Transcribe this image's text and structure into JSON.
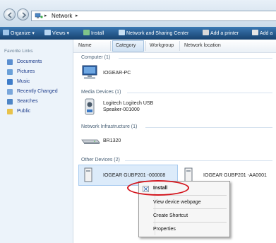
{
  "address": {
    "location": "Network"
  },
  "toolbar": {
    "organize": "Organize",
    "views": "Views",
    "install": "Install",
    "network_sharing": "Network and Sharing Center",
    "add_printer": "Add a printer",
    "add_more": "Add a"
  },
  "leftnav": {
    "title": "Favorite Links",
    "items": [
      {
        "label": "Documents"
      },
      {
        "label": "Pictures"
      },
      {
        "label": "Music"
      },
      {
        "label": "Recently Changed"
      },
      {
        "label": "Searches"
      },
      {
        "label": "Public"
      }
    ]
  },
  "columns": [
    "Name",
    "Category",
    "Workgroup",
    "Network location"
  ],
  "groups": {
    "computer": {
      "title": "Computer (1)",
      "items": [
        {
          "label": "IOGEAR-PC"
        }
      ]
    },
    "media": {
      "title": "Media Devices (1)",
      "items": [
        {
          "line1": "Logitech Logitech USB",
          "line2": "Speaker-001000"
        }
      ]
    },
    "infra": {
      "title": "Network Infrastructure (1)",
      "items": [
        {
          "label": "BR1320"
        }
      ]
    },
    "other": {
      "title": "Other Devices (2)",
      "items": [
        {
          "label": "IOGEAR GUBP201 -000008"
        },
        {
          "label": "IOGEAR GUBP201 -AA0001"
        }
      ]
    }
  },
  "context_menu": {
    "items": [
      {
        "label": "Install"
      },
      {
        "label": "View device webpage"
      },
      {
        "label": "Create Shortcut"
      },
      {
        "label": "Properties"
      }
    ]
  },
  "colors": {
    "toolbar": "#17426f",
    "highlight": "#d4141c",
    "link": "#1c3b8a"
  }
}
